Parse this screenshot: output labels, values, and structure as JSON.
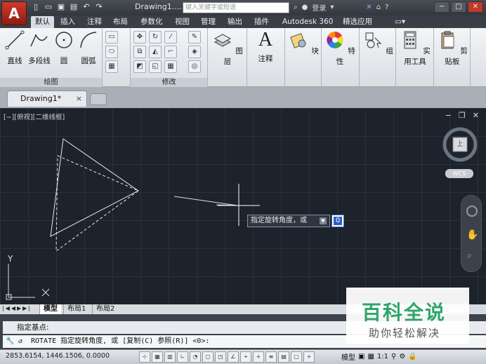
{
  "app": {
    "logo": "A",
    "doc_title": "Drawing1....",
    "search_placeholder": "键入关键字或短语",
    "login_label": "登录"
  },
  "menu_tabs": [
    "默认",
    "插入",
    "注释",
    "布局",
    "参数化",
    "视图",
    "管理",
    "输出",
    "插件",
    "Autodesk 360",
    "精选应用"
  ],
  "ribbon": {
    "draw_tools": [
      "直线",
      "多段线",
      "圆",
      "圆弧"
    ],
    "draw_label": "绘图",
    "modify_label": "修改",
    "big_tools": [
      "图层",
      "注释",
      "块",
      "特性",
      "组",
      "实用工具",
      "剪贴板"
    ],
    "annot_letter": "A"
  },
  "file_tab": {
    "label": "Drawing1*",
    "close": "×"
  },
  "viewport": {
    "label": "[−][俯视][二维线框]",
    "wcs": "WCS",
    "compass": "上",
    "y_axis": "Y",
    "x_axis": "X"
  },
  "tooltip": {
    "prompt": "指定旋转角度，或",
    "input_value": "0"
  },
  "layout_tabs": [
    "模型",
    "布局1",
    "布局2"
  ],
  "command": {
    "history": "指定基点:",
    "line": "ROTATE 指定旋转角度, 或 [复制(C) 参照(R)] <0>:"
  },
  "status": {
    "coords": "2853.6154, 1446.1506, 0.0000",
    "model_label": "模型",
    "scale": "1:1"
  },
  "watermark": {
    "title": "百科全说",
    "subtitle": "助你轻松解决"
  },
  "colors": {
    "canvas": "#1c232d",
    "accent_red": "#c0281b",
    "watermark_green": "#2ea56a"
  }
}
